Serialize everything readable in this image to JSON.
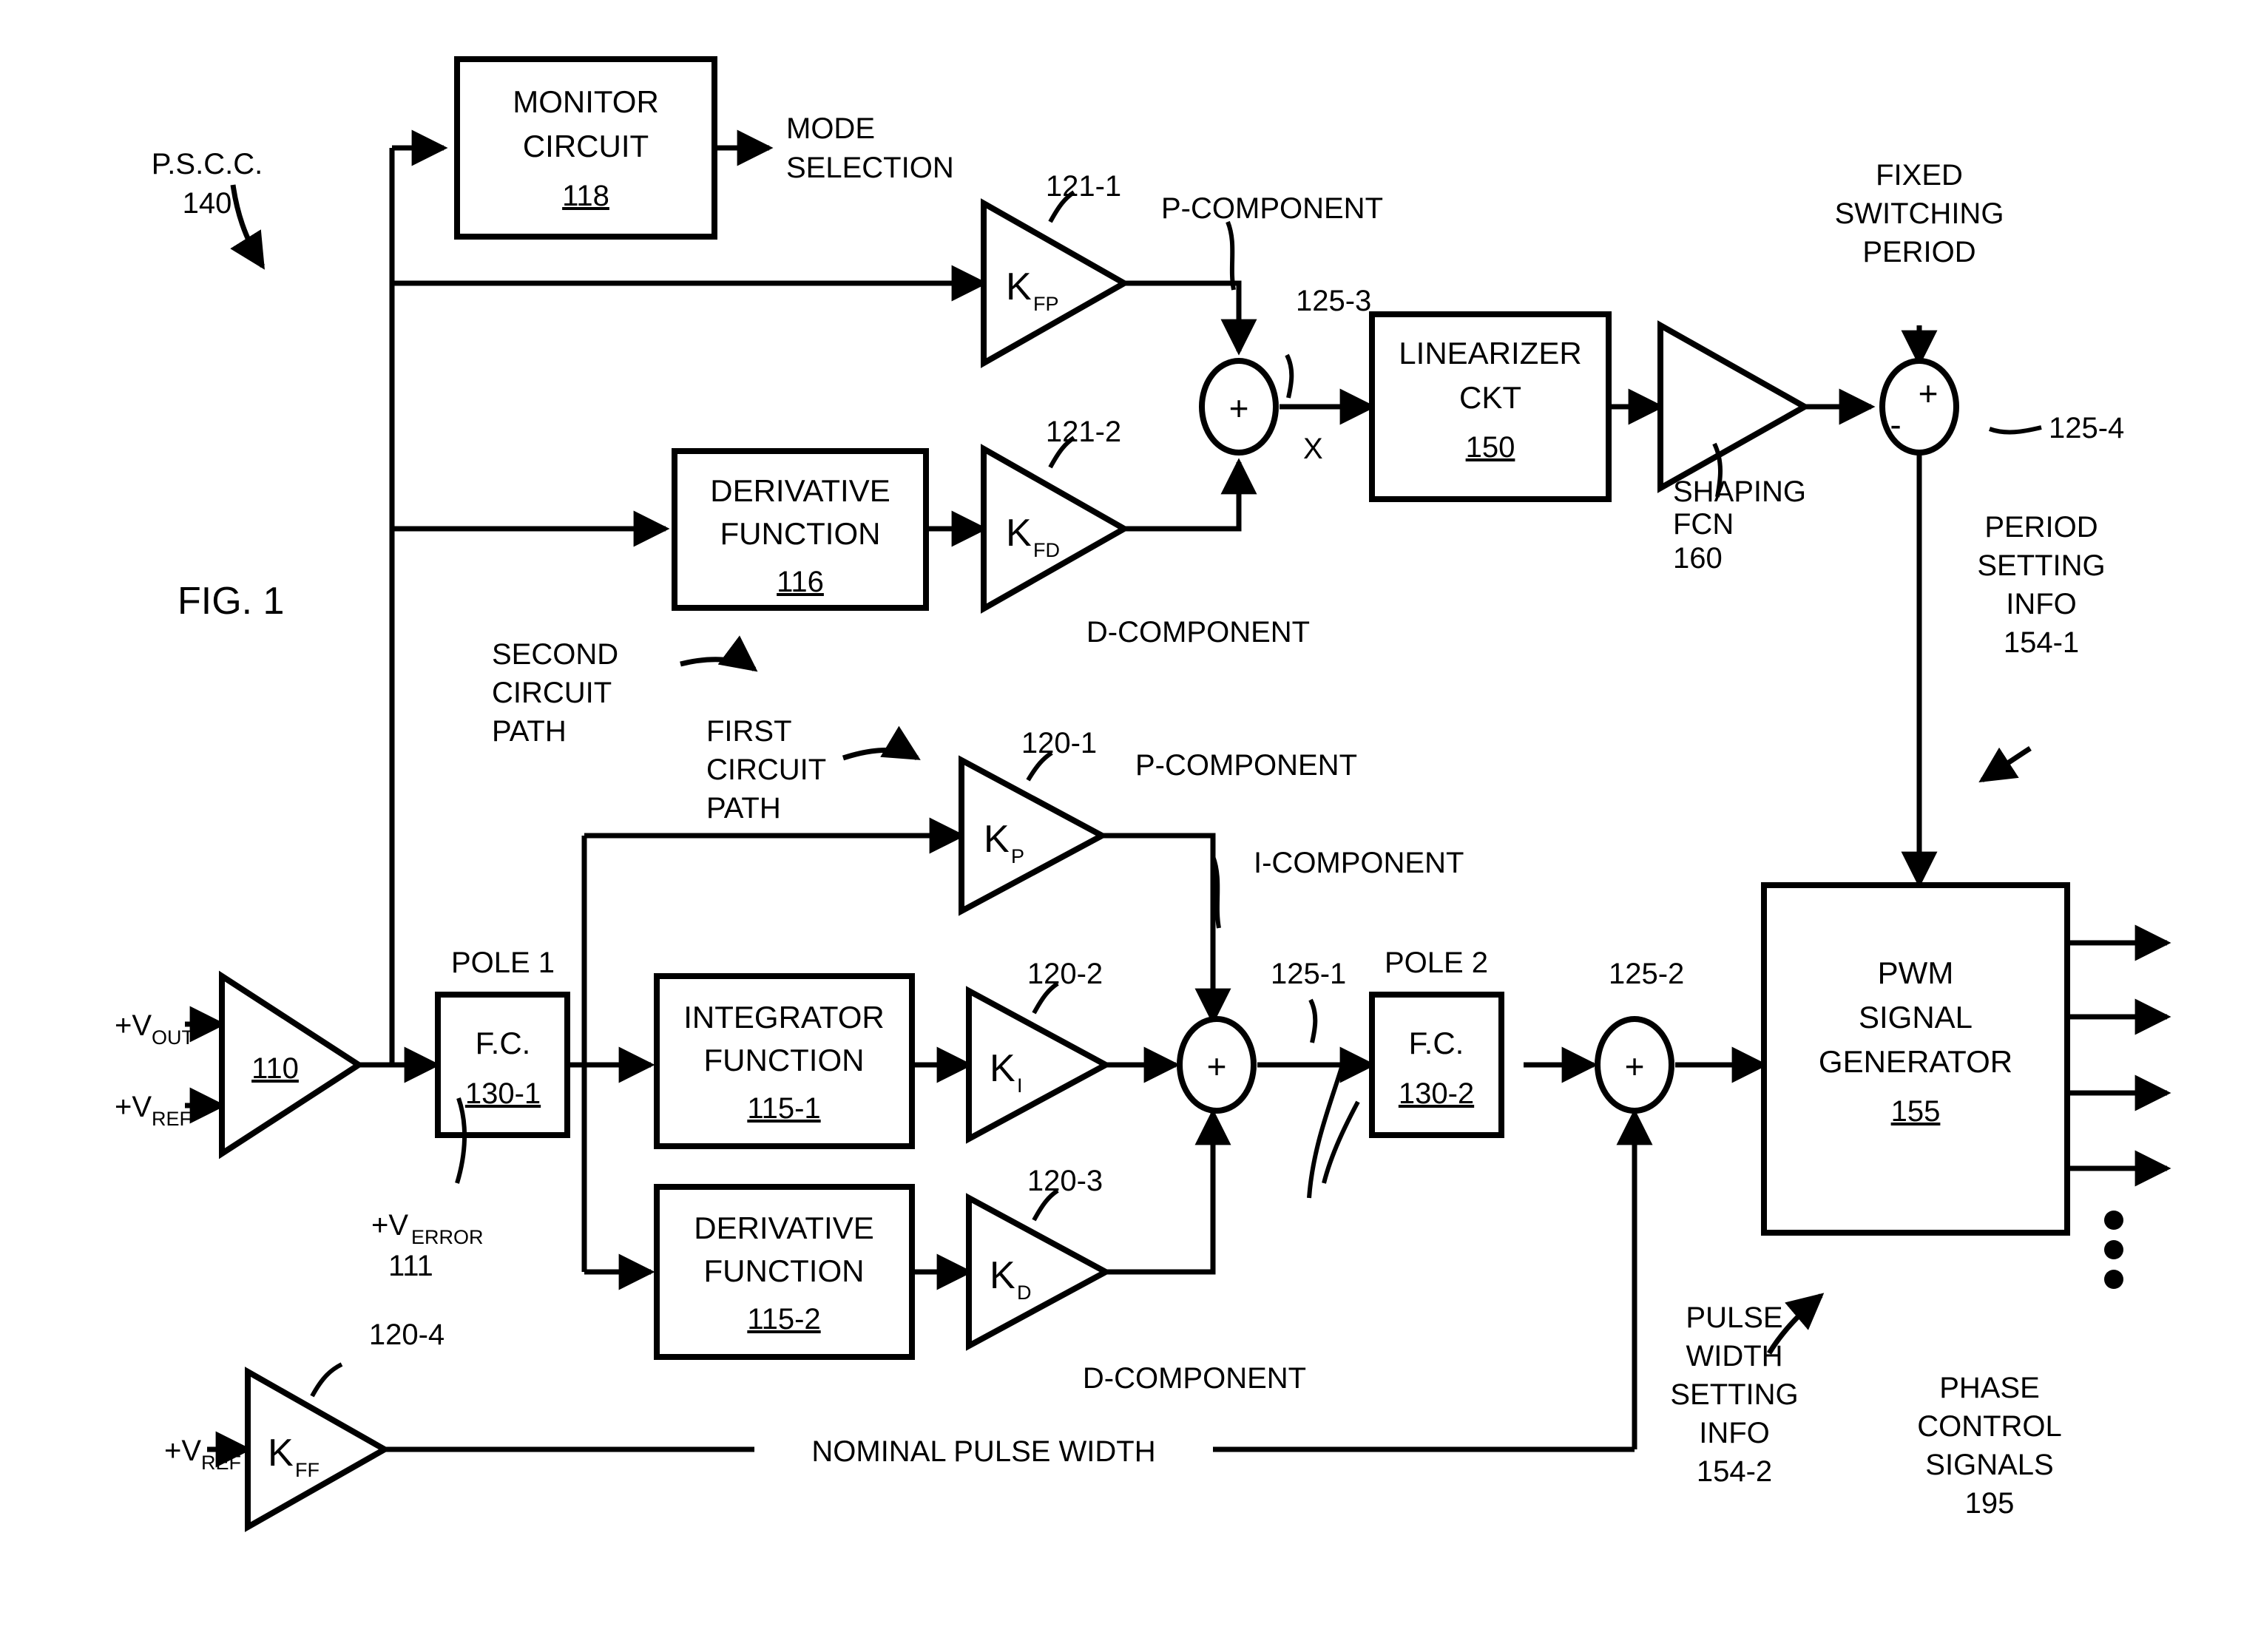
{
  "figure": {
    "label": "FIG. 1",
    "system_label": "P.S.C.C.",
    "system_ref": "140"
  },
  "blocks": {
    "monitor": {
      "line1": "MONITOR",
      "line2": "CIRCUIT",
      "ref": "118"
    },
    "derivative_upper": {
      "line1": "DERIVATIVE",
      "line2": "FUNCTION",
      "ref": "116"
    },
    "linearizer": {
      "line1": "LINEARIZER",
      "line2": "CKT",
      "ref": "150"
    },
    "fc1": {
      "line1": "F.C.",
      "ref": "130-1",
      "pole": "POLE 1"
    },
    "fc2": {
      "line1": "F.C.",
      "ref": "130-2",
      "pole": "POLE 2"
    },
    "integrator": {
      "line1": "INTEGRATOR",
      "line2": "FUNCTION",
      "ref": "115-1"
    },
    "derivative_lower": {
      "line1": "DERIVATIVE",
      "line2": "FUNCTION",
      "ref": "115-2"
    },
    "pwm": {
      "line1": "PWM",
      "line2": "SIGNAL",
      "line3": "GENERATOR",
      "ref": "155"
    }
  },
  "amplifiers": {
    "error_amp": {
      "ref": "110"
    },
    "kfp": {
      "gain": "K",
      "sub": "FP",
      "ref": "121-1"
    },
    "kfd": {
      "gain": "K",
      "sub": "FD",
      "ref": "121-2"
    },
    "kp": {
      "gain": "K",
      "sub": "P",
      "ref": "120-1"
    },
    "ki": {
      "gain": "K",
      "sub": "I",
      "ref": "120-2"
    },
    "kd": {
      "gain": "K",
      "sub": "D",
      "ref": "120-3"
    },
    "kff": {
      "gain": "K",
      "sub": "FF",
      "ref": "120-4"
    },
    "shaping": {
      "line1": "SHAPING",
      "line2": "FCN",
      "ref": "160"
    }
  },
  "summers": {
    "s125_1": {
      "ref": "125-1",
      "sign_center": "+"
    },
    "s125_2": {
      "ref": "125-2",
      "sign_center": "+"
    },
    "s125_3": {
      "ref": "125-3",
      "sign_center": "+"
    },
    "s125_4": {
      "ref": "125-4",
      "sign_top": "+",
      "sign_left": "-"
    }
  },
  "signals": {
    "v_out": {
      "base": "+V",
      "sub": "OUT"
    },
    "v_ref_top": {
      "base": "+V",
      "sub": "REF"
    },
    "v_ref_bottom": {
      "base": "+V",
      "sub": "REF"
    },
    "v_error": {
      "base": "+V",
      "sub": "ERROR",
      "ref": "111"
    },
    "mode_selection": {
      "line1": "MODE",
      "line2": "SELECTION"
    },
    "p_component_upper": "P-COMPONENT",
    "d_component_upper": "D-COMPONENT",
    "p_component_lower": "P-COMPONENT",
    "i_component": "I-COMPONENT",
    "d_component_lower": "D-COMPONENT",
    "node_x": "X",
    "fixed_switching_period": {
      "line1": "FIXED",
      "line2": "SWITCHING",
      "line3": "PERIOD"
    },
    "period_setting_info": {
      "line1": "PERIOD",
      "line2": "SETTING",
      "line3": "INFO",
      "ref": "154-1"
    },
    "pulse_width_setting_info": {
      "line1": "PULSE",
      "line2": "WIDTH",
      "line3": "SETTING",
      "line4": "INFO",
      "ref": "154-2"
    },
    "phase_control_signals": {
      "line1": "PHASE",
      "line2": "CONTROL",
      "line3": "SIGNALS",
      "ref": "195"
    },
    "nominal_pulse_width": "NOMINAL PULSE WIDTH",
    "first_circuit_path": {
      "line1": "FIRST",
      "line2": "CIRCUIT",
      "line3": "PATH"
    },
    "second_circuit_path": {
      "line1": "SECOND",
      "line2": "CIRCUIT",
      "line3": "PATH"
    }
  },
  "colors": {
    "ink": "#000000",
    "paper": "#ffffff"
  }
}
